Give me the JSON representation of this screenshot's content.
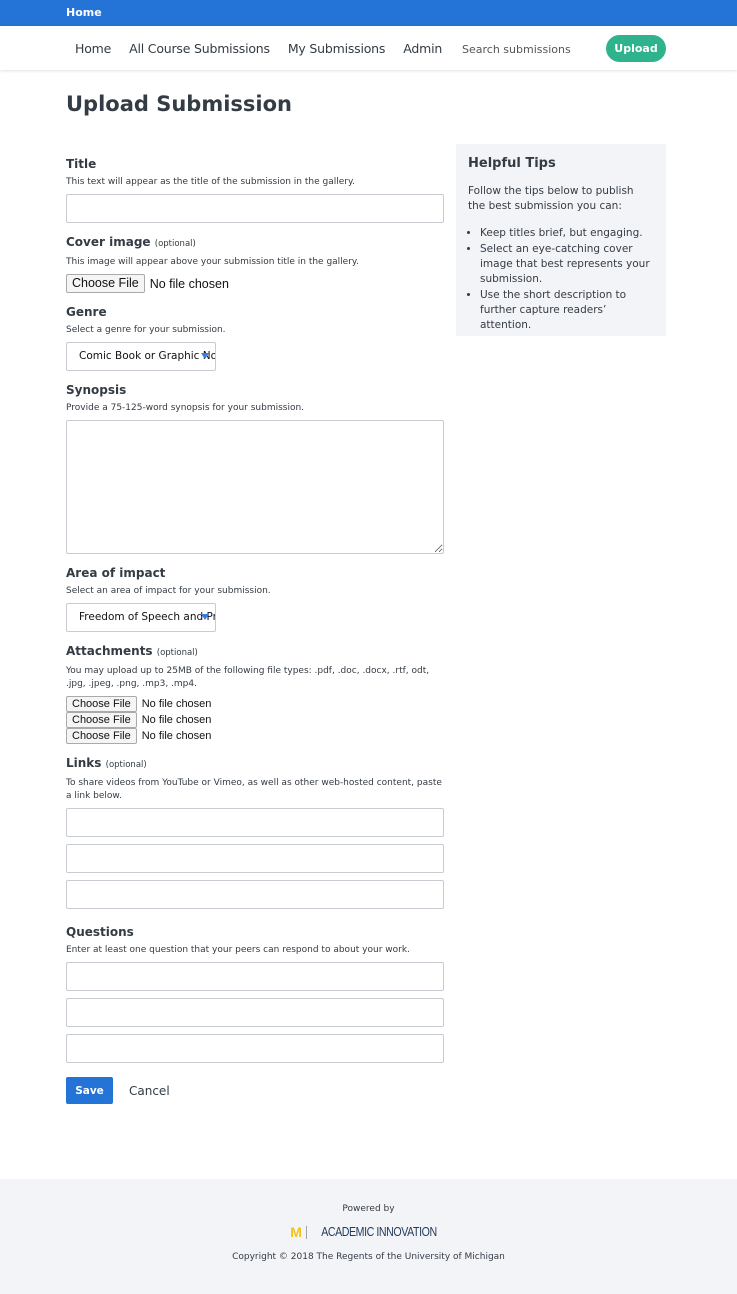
{
  "topbar": {
    "home_link": "Home"
  },
  "nav": {
    "links": [
      "Home",
      "All Course Submissions",
      "My Submissions",
      "Admin"
    ],
    "search_placeholder": "Search submissions",
    "upload_label": "Upload"
  },
  "page_title": "Upload Submission",
  "form": {
    "title": {
      "label": "Title",
      "help": "This text will appear as the title of the submission in the gallery.",
      "value": ""
    },
    "cover_image": {
      "label": "Cover image",
      "optional": "(optional)",
      "help": "This image will appear above your submission title in the gallery.",
      "button": "Choose File",
      "status": "No file chosen"
    },
    "genre": {
      "label": "Genre",
      "help": "Select a genre for your submission.",
      "selected": "Comic Book or Graphic Novel"
    },
    "synopsis": {
      "label": "Synopsis",
      "help": "Provide a 75-125-word synopsis for your submission.",
      "value": ""
    },
    "area_of_impact": {
      "label": "Area of impact",
      "help": "Select an area of impact for your submission.",
      "selected": "Freedom of Speech and Press"
    },
    "attachments": {
      "label": "Attachments",
      "optional": "(optional)",
      "help": "You may upload up to 25MB of the following file types: .pdf, .doc, .docx, .rtf, odt, .jpg, .jpeg, .png, .mp3, .mp4.",
      "files": [
        {
          "button": "Choose File",
          "status": "No file chosen"
        },
        {
          "button": "Choose File",
          "status": "No file chosen"
        },
        {
          "button": "Choose File",
          "status": "No file chosen"
        }
      ]
    },
    "links": {
      "label": "Links",
      "optional": "(optional)",
      "help": "To share videos from YouTube or Vimeo, as well as other web-hosted content, paste a link below.",
      "values": [
        "",
        "",
        ""
      ]
    },
    "questions": {
      "label": "Questions",
      "help": "Enter at least one question that your peers can respond to about your work.",
      "values": [
        "",
        "",
        ""
      ]
    },
    "save_label": "Save",
    "cancel_label": "Cancel"
  },
  "tips": {
    "heading": "Helpful Tips",
    "intro": "Follow the tips below to publish the best submission you can:",
    "items": [
      "Keep titles brief, but engaging.",
      "Select an eye-catching cover image that best represents your submission.",
      "Use the short description to further capture readers’ attention."
    ]
  },
  "footer": {
    "powered_by": "Powered by",
    "logo_mark": "M",
    "logo_text": "ACADEMIC INNOVATION",
    "copyright": "Copyright © 2018 The Regents of the University of Michigan"
  },
  "colors": {
    "topbar": "#2473d6",
    "upload_button": "#2eb38c",
    "save_button": "#2473d6",
    "panel_bg": "#f3f4f8",
    "logo_maize": "#f3c21a"
  }
}
